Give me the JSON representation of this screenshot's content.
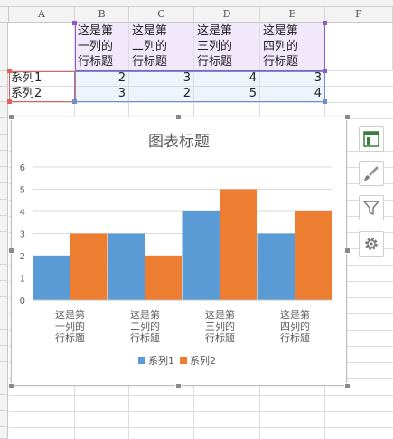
{
  "sheet": {
    "columns": [
      "A",
      "B",
      "C",
      "D",
      "E",
      "F"
    ],
    "header_cells": [
      "这是第\n一列的\n行标题",
      "这是第\n二列的\n行标题",
      "这是第\n三列的\n行标题",
      "这是第\n四列的\n行标题"
    ],
    "rows": [
      {
        "label": "系列1",
        "values": [
          "2",
          "3",
          "4",
          "3"
        ]
      },
      {
        "label": "系列2",
        "values": [
          "3",
          "2",
          "5",
          "4"
        ]
      }
    ],
    "colors": {
      "header_highlight": "#f1e8fb",
      "data_highlight": "#eef4fb",
      "label_border": "#e06060",
      "header_border": "#8a5cc8",
      "data_border": "#6f8fd0"
    }
  },
  "chart_data": {
    "type": "bar",
    "title": "图表标题",
    "categories": [
      "这是第\n一列的\n行标题",
      "这是第\n二列的\n行标题",
      "这是第\n三列的\n行标题",
      "这是第\n四列的\n行标题"
    ],
    "series": [
      {
        "name": "系列1",
        "values": [
          2,
          3,
          4,
          3
        ],
        "color": "#5b9bd5"
      },
      {
        "name": "系列2",
        "values": [
          3,
          2,
          5,
          4
        ],
        "color": "#ed7d31"
      }
    ],
    "ylim": [
      0,
      6
    ],
    "yticks": [
      0,
      1,
      2,
      3,
      4,
      5,
      6
    ],
    "grid": true,
    "legend": "bottom"
  },
  "side_toolbar": [
    {
      "icon": "chart-elements-icon"
    },
    {
      "icon": "brush-icon"
    },
    {
      "icon": "filter-icon"
    },
    {
      "icon": "gear-icon"
    }
  ]
}
